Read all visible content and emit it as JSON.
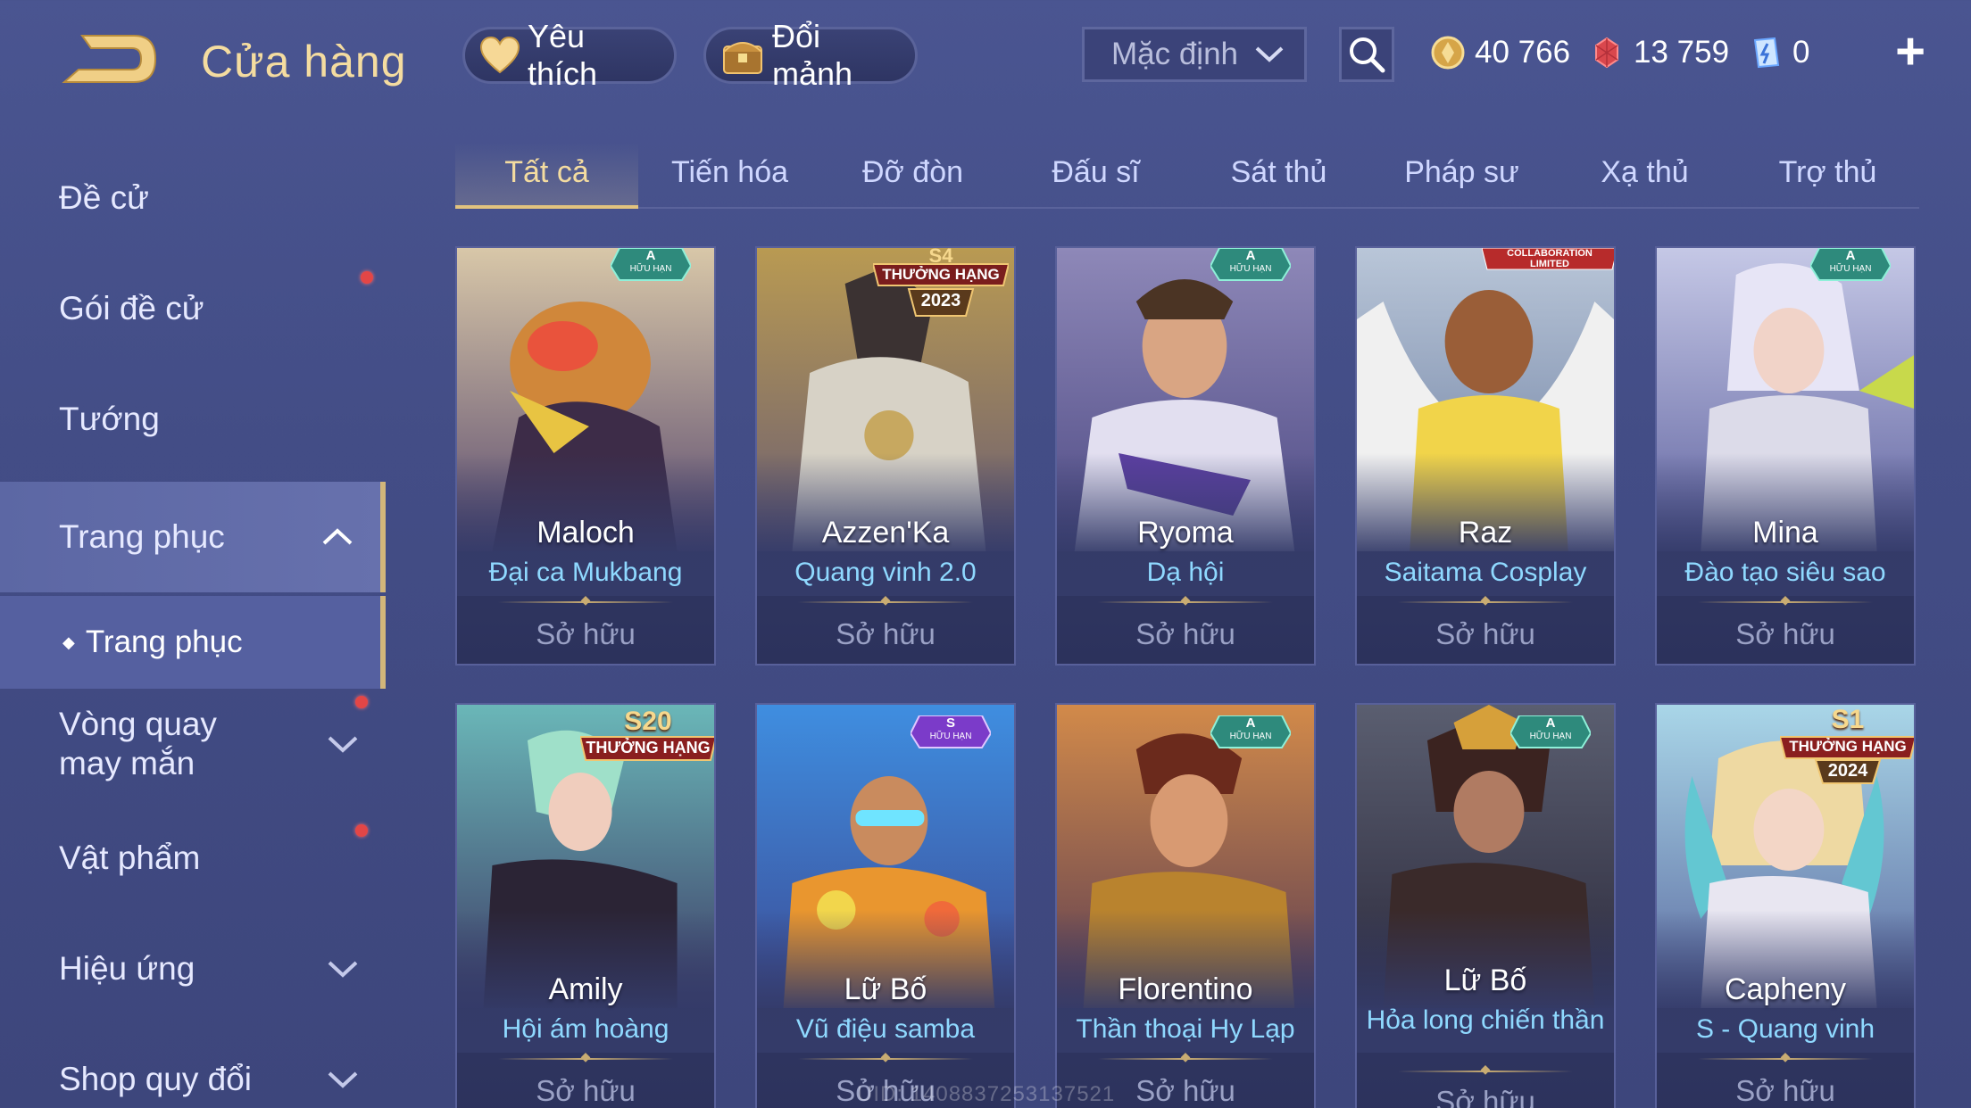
{
  "header": {
    "title": "Cửa hàng",
    "favorite_label": "Yêu thích",
    "exchange_label": "Đổi mảnh",
    "sort_selected": "Mặc định",
    "currencies": [
      {
        "icon": "gold-coin-icon",
        "value": "40 766"
      },
      {
        "icon": "red-gem-icon",
        "value": "13 759"
      },
      {
        "icon": "voucher-icon",
        "value": "0"
      }
    ]
  },
  "sidebar": {
    "items": [
      {
        "label": "Đề cử"
      },
      {
        "label": "Gói đề cử"
      },
      {
        "label": "Tướng"
      },
      {
        "label": "Trang phục"
      },
      {
        "label": "Vòng quay may mắn"
      },
      {
        "label": "Vật phẩm"
      },
      {
        "label": "Hiệu ứng"
      },
      {
        "label": "Shop quy đổi"
      }
    ],
    "sub_item": "Trang phục"
  },
  "tabs": [
    "Tất cả",
    "Tiến hóa",
    "Đỡ đòn",
    "Đấu sĩ",
    "Sát thủ",
    "Pháp sư",
    "Xạ thủ",
    "Trợ thủ"
  ],
  "cards": [
    {
      "name": "Maloch",
      "skin": "Đại ca Mukbang",
      "status": "Sở hữu",
      "badge_top": "A",
      "badge_bottom": "HỮU HẠN"
    },
    {
      "name": "Azzen'Ka",
      "skin": "Quang vinh 2.0",
      "status": "Sở hữu",
      "badge_top": "S4",
      "badge_bottom": "THƯỞNG HẠNG",
      "badge_year": "2023"
    },
    {
      "name": "Ryoma",
      "skin": "Dạ hội",
      "status": "Sở hữu",
      "badge_top": "A",
      "badge_bottom": "HỮU HẠN"
    },
    {
      "name": "Raz",
      "skin": "Saitama Cosplay",
      "status": "Sở hữu",
      "badge_top": "COLLABORATION",
      "badge_bottom": "LIMITED"
    },
    {
      "name": "Mina",
      "skin": "Đào tạo siêu sao",
      "status": "Sở hữu",
      "badge_top": "A",
      "badge_bottom": "HỮU HẠN"
    },
    {
      "name": "Amily",
      "skin": "Hội ám hoàng",
      "status": "Sở hữu",
      "badge_top": "S20",
      "badge_bottom": "THƯỞNG HẠNG"
    },
    {
      "name": "Lữ Bố",
      "skin": "Vũ điệu samba",
      "status": "Sở hữu",
      "badge_top": "S",
      "badge_bottom": "HỮU HẠN"
    },
    {
      "name": "Florentino",
      "skin": "Thần thoại Hy Lạp",
      "status": "Sở hữu",
      "badge_top": "A",
      "badge_bottom": "HỮU HẠN"
    },
    {
      "name": "Lữ Bố",
      "skin": "Hỏa long chiến thần",
      "status": "Sở hữu",
      "badge_top": "A",
      "badge_bottom": "HỮU HẠN"
    },
    {
      "name": "Capheny",
      "skin": "S - Quang vinh",
      "status": "Sở hữu",
      "badge_top": "S1",
      "badge_bottom": "THƯỞNG HẠNG",
      "badge_year": "2024"
    }
  ],
  "uid": "UID: 1408837253137521",
  "colors": {
    "accent_gold": "#f4dca0",
    "skin_text": "#8fd9ff",
    "notification": "#e34646"
  }
}
